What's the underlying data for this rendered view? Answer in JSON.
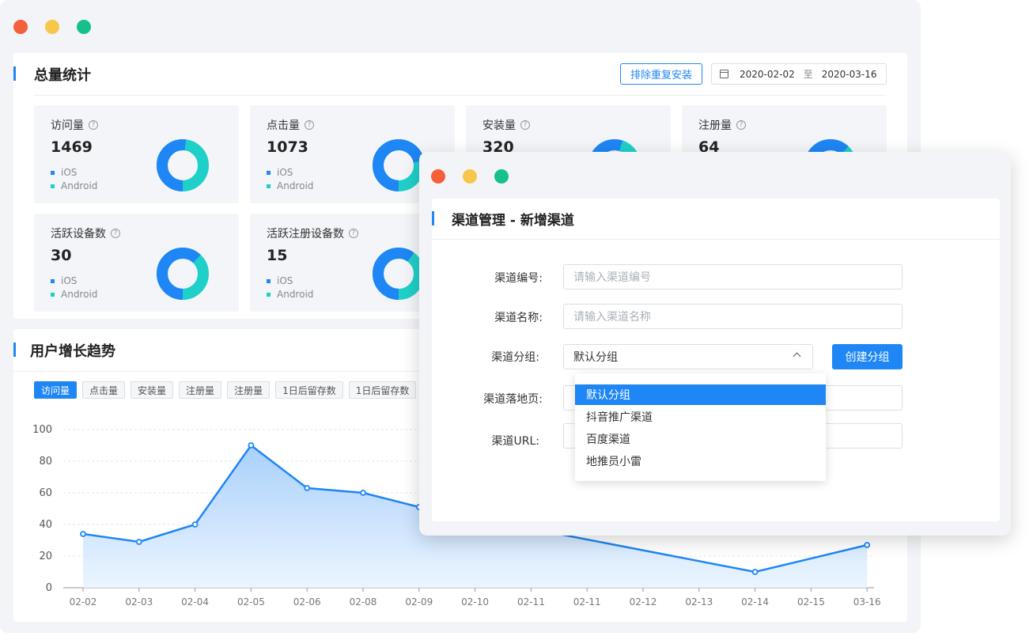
{
  "colors": {
    "accent": "#1f86f5",
    "ios": "#1f86f5",
    "android": "#1fd0c9"
  },
  "overview": {
    "title": "总量统计",
    "exclude_button": "排除重复安装",
    "date_start": "2020-02-02",
    "date_sep": "至",
    "date_end": "2020-03-16",
    "legend_ios": "iOS",
    "legend_android": "Android",
    "help_glyph": "?",
    "cards": [
      {
        "title": "访问量",
        "value": "1469"
      },
      {
        "title": "点击量",
        "value": "1073"
      },
      {
        "title": "安装量",
        "value": "320"
      },
      {
        "title": "注册量",
        "value": "64"
      },
      {
        "title": "活跃设备数",
        "value": "30"
      },
      {
        "title": "活跃注册设备数",
        "value": "15"
      }
    ]
  },
  "trend": {
    "title": "用户增长趋势",
    "tabs": [
      "访问量",
      "点击量",
      "安装量",
      "注册量",
      "注册量",
      "1日后留存数",
      "1日后留存数"
    ],
    "active_tab": 0
  },
  "chart_data": {
    "type": "area",
    "x": [
      "02-02",
      "02-03",
      "02-04",
      "02-05",
      "02-06",
      "02-08",
      "02-09",
      "02-10",
      "02-11",
      "02-11",
      "02-12",
      "02-13",
      "02-14",
      "02-15",
      "03-16"
    ],
    "series": [
      {
        "values": [
          34,
          29,
          40,
          90,
          63,
          60,
          51,
          null,
          null,
          null,
          null,
          null,
          10,
          null,
          27
        ]
      }
    ],
    "yticks": [
      0,
      20,
      40,
      60,
      80,
      100
    ],
    "ylim": [
      0,
      100
    ],
    "grid": true
  },
  "modal": {
    "title": "渠道管理 - 新增渠道",
    "fields": {
      "code_label": "渠道编号:",
      "code_placeholder": "请输入渠道编号",
      "name_label": "渠道名称:",
      "name_placeholder": "请输入渠道名称",
      "group_label": "渠道分组:",
      "group_value": "默认分组",
      "landing_label": "渠道落地页:",
      "url_label": "渠道URL:"
    },
    "create_group_button": "创建分组",
    "dropdown_options": [
      "默认分组",
      "抖音推广渠道",
      "百度渠道",
      "地推员小雷"
    ],
    "dropdown_selected": 0
  }
}
